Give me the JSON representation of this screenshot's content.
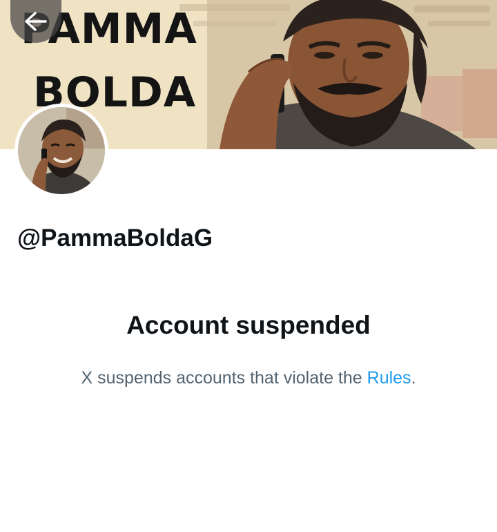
{
  "banner": {
    "title_line_1": "PAMMA",
    "title_line_2": "BOLDA"
  },
  "back_button": {
    "icon": "arrow-left-icon"
  },
  "profile": {
    "handle": "@PammaBoldaG"
  },
  "suspension": {
    "title": "Account suspended",
    "text_before_link": "X suspends accounts that violate the ",
    "link_label": "Rules",
    "text_after_link": "."
  },
  "colors": {
    "text_primary": "#0f1419",
    "text_secondary": "#536471",
    "link": "#1d9bf0",
    "back_button_bg": "#464646"
  }
}
